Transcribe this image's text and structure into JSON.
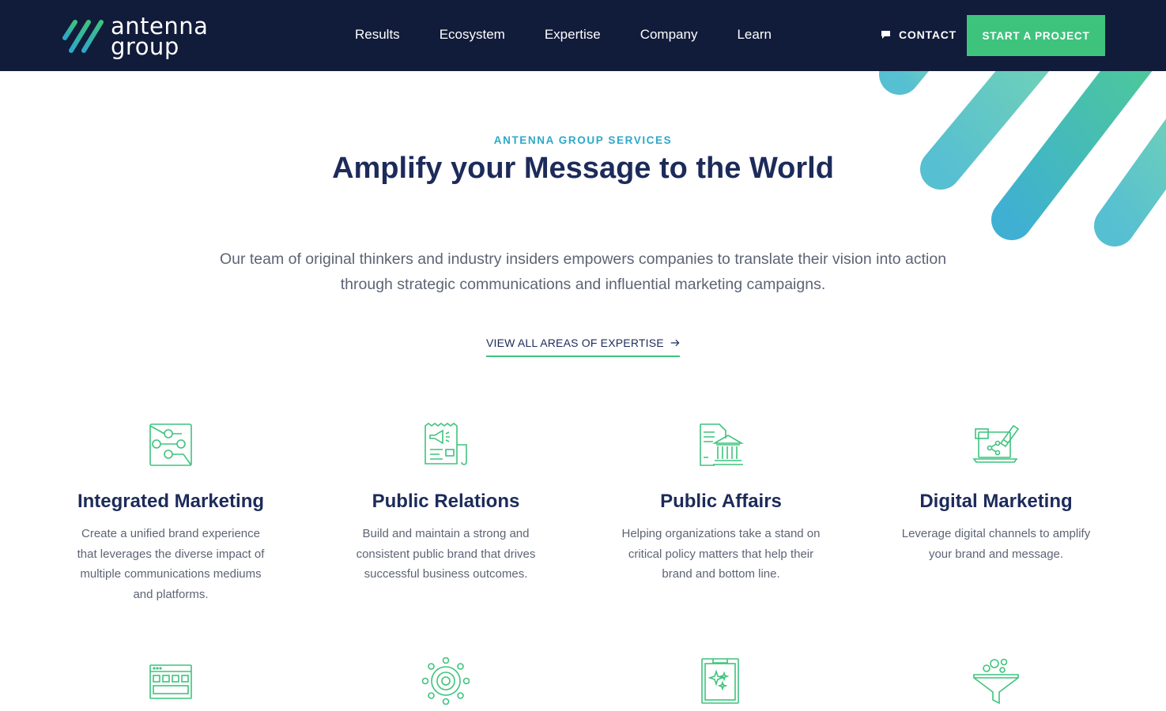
{
  "brand": {
    "logo_line1": "antenna",
    "logo_line2": "group",
    "logo_icon": "diagonal-stripes-logo"
  },
  "nav": {
    "items": [
      {
        "label": "Results"
      },
      {
        "label": "Ecosystem"
      },
      {
        "label": "Expertise"
      },
      {
        "label": "Company"
      },
      {
        "label": "Learn"
      }
    ],
    "contact_label": "CONTACT",
    "contact_icon": "chat-bubble-icon",
    "cta_label": "START A PROJECT"
  },
  "hero": {
    "eyebrow": "ANTENNA GROUP SERVICES",
    "title": "Amplify your Message to the World",
    "lead": "Our team of original thinkers and industry insiders empowers companies to translate their vision into action through strategic communications and influential marketing campaigns.",
    "link_label": "VIEW ALL AREAS OF EXPERTISE",
    "link_icon": "arrow-right-icon"
  },
  "services": [
    {
      "title": "Integrated Marketing",
      "description": "Create a unified brand experience that leverages the diverse impact of multiple communications mediums and platforms.",
      "icon": "network-nodes-icon"
    },
    {
      "title": "Public Relations",
      "description": "Build and maintain a strong and consistent public brand that drives successful business outcomes.",
      "icon": "newspaper-megaphone-icon"
    },
    {
      "title": "Public Affairs",
      "description": "Helping organizations take a stand on critical policy matters that help their brand and bottom line.",
      "icon": "government-building-icon"
    },
    {
      "title": "Digital Marketing",
      "description": "Leverage digital channels to amplify your brand and message.",
      "icon": "laptop-share-icon"
    }
  ],
  "more_service_icons": [
    "browser-window-icon",
    "target-circle-icon",
    "clipboard-sparkle-icon",
    "funnel-icon"
  ],
  "colors": {
    "nav_bg": "#111b3a",
    "accent_green": "#3ec37d",
    "accent_blue": "#2ea7c9",
    "heading": "#1c2b5a",
    "body_text": "#5d6474"
  }
}
